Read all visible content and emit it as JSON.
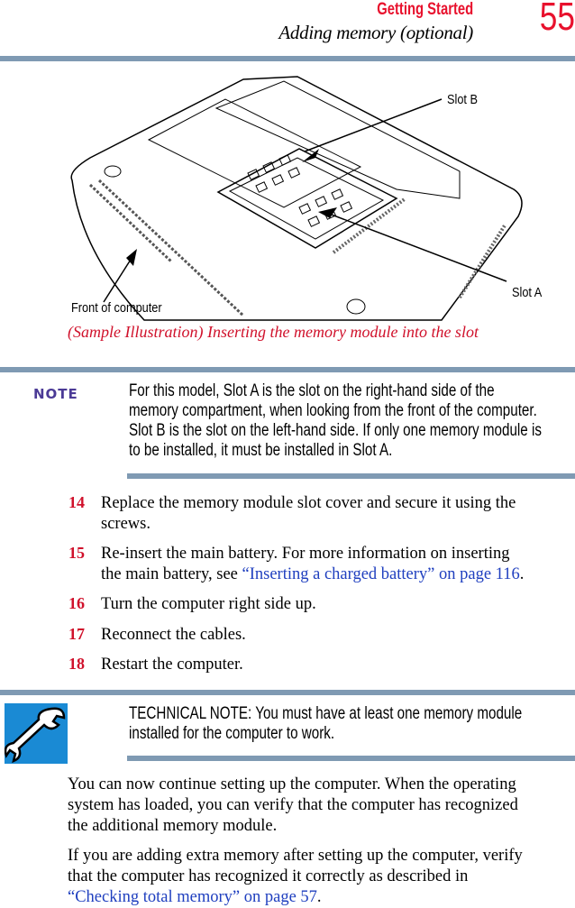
{
  "header": {
    "section": "Getting Started",
    "title": "Adding memory (optional)",
    "page_number": "55"
  },
  "figure": {
    "label_slot_b": "Slot B",
    "label_slot_a": "Slot A",
    "label_front": "Front of computer",
    "caption": "(Sample Illustration) Inserting the memory module into the slot"
  },
  "note": {
    "label": "NOTE",
    "lines": [
      "For this model, Slot A is the slot on the right-hand side of the",
      "memory compartment, when looking from the front of the computer.",
      "Slot B is the slot on the left-hand side. If only one memory module is",
      "to be installed, it must be installed in Slot A."
    ]
  },
  "steps": [
    {
      "number": "14",
      "lines": [
        "Replace the memory module slot cover and secure it using the",
        "screws."
      ]
    },
    {
      "number": "15",
      "line1": "Re-insert the main battery. For more information on inserting",
      "line2_pre": "the main battery, see ",
      "line2_link": "“Inserting a charged battery” on page 116",
      "line2_post": "."
    },
    {
      "number": "16",
      "lines": [
        "Turn the computer right side up."
      ]
    },
    {
      "number": "17",
      "lines": [
        "Reconnect the cables."
      ]
    },
    {
      "number": "18",
      "lines": [
        "Restart the computer."
      ]
    }
  ],
  "tech_note": {
    "icon": "wrench-icon",
    "lines": [
      "TECHNICAL NOTE: You must have at least one memory module",
      "installed for the computer to work."
    ]
  },
  "paragraphs": [
    {
      "lines": [
        "You can now continue setting up the computer. When the operating",
        "system has loaded, you can verify that the computer has recognized",
        "the additional memory module."
      ]
    },
    {
      "lines": [
        "If you are adding extra memory after setting up the computer, verify",
        "that the computer has recognized it correctly as described in"
      ],
      "link": "“Checking total memory” on page 57",
      "post": "."
    }
  ],
  "colors": {
    "accent_red": "#e8112d",
    "rule": "#7f9ab3",
    "link": "#1f3fbf",
    "note": "#4b3a96",
    "icon_bg": "#1a8ad4"
  }
}
